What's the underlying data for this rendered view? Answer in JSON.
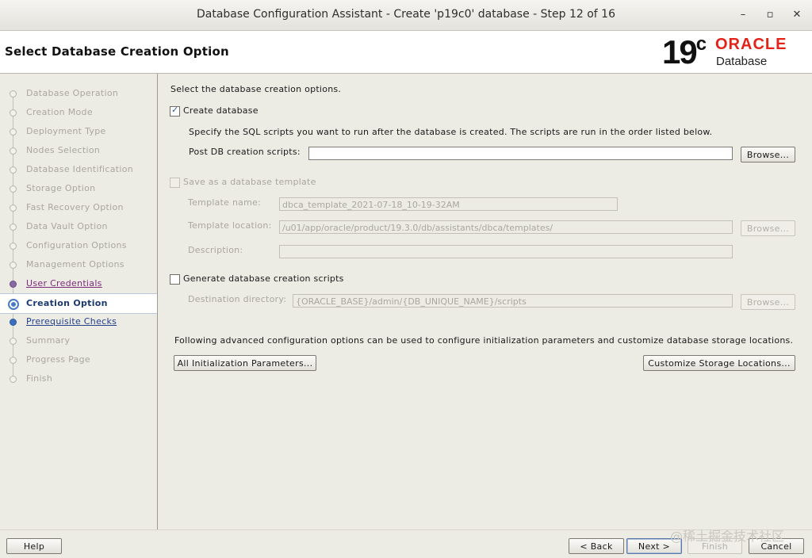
{
  "window": {
    "title": "Database Configuration Assistant - Create 'p19c0' database - Step 12 of 16",
    "minimize": "–",
    "maximize": "▫",
    "close": "✕"
  },
  "header": {
    "title": "Select Database Creation Option",
    "logo_number": "19",
    "logo_sup": "c",
    "logo_brand": "ORACLE",
    "logo_product": "Database"
  },
  "sidebar": {
    "steps": [
      {
        "label": "Database Operation",
        "state": "inactive"
      },
      {
        "label": "Creation Mode",
        "state": "inactive"
      },
      {
        "label": "Deployment Type",
        "state": "inactive"
      },
      {
        "label": "Nodes Selection",
        "state": "inactive"
      },
      {
        "label": "Database Identification",
        "state": "inactive"
      },
      {
        "label": "Storage Option",
        "state": "inactive"
      },
      {
        "label": "Fast Recovery Option",
        "state": "inactive"
      },
      {
        "label": "Data Vault Option",
        "state": "inactive"
      },
      {
        "label": "Configuration Options",
        "state": "inactive"
      },
      {
        "label": "Management Options",
        "state": "inactive"
      },
      {
        "label": "User Credentials",
        "state": "done"
      },
      {
        "label": "Creation Option",
        "state": "current"
      },
      {
        "label": "Prerequisite Checks",
        "state": "link"
      },
      {
        "label": "Summary",
        "state": "inactive"
      },
      {
        "label": "Progress Page",
        "state": "inactive"
      },
      {
        "label": "Finish",
        "state": "inactive"
      }
    ]
  },
  "main": {
    "intro": "Select the database creation options.",
    "create_db": {
      "label": "Create database",
      "checked": true,
      "desc": "Specify the SQL scripts you want to run after the database is created. The scripts are run in the order listed below.",
      "post_label": "Post DB creation scripts:",
      "post_value": "",
      "browse": "Browse..."
    },
    "template": {
      "label": "Save as a database template",
      "checked": false,
      "name_label": "Template name:",
      "name_value": "dbca_template_2021-07-18_10-19-32AM",
      "location_label": "Template location:",
      "location_value": "/u01/app/oracle/product/19.3.0/db/assistants/dbca/templates/",
      "browse": "Browse...",
      "desc_label": "Description:",
      "desc_value": ""
    },
    "scripts": {
      "label": "Generate database creation scripts",
      "checked": false,
      "dest_label": "Destination directory:",
      "dest_value": "{ORACLE_BASE}/admin/{DB_UNIQUE_NAME}/scripts",
      "browse": "Browse..."
    },
    "advanced_text": "Following advanced configuration options can be used to configure initialization parameters and customize database storage locations.",
    "init_params_btn": "All Initialization Parameters...",
    "storage_btn": "Customize Storage Locations..."
  },
  "footer": {
    "help": "Help",
    "back": "< Back",
    "next": "Next >",
    "finish": "Finish",
    "cancel": "Cancel"
  },
  "watermark": "@稀土掘金技术社区"
}
